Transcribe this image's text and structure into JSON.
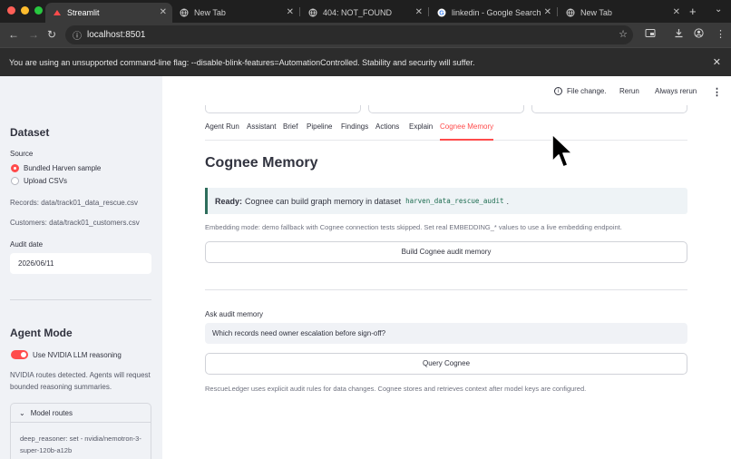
{
  "browser": {
    "tabs": [
      {
        "label": "Streamlit",
        "icon": "streamlit-icon",
        "active": true
      },
      {
        "label": "New Tab",
        "icon": "globe-icon",
        "active": false
      },
      {
        "label": "404: NOT_FOUND",
        "icon": "globe-icon",
        "active": false
      },
      {
        "label": "linkedin - Google Search",
        "icon": "google-icon",
        "active": false
      },
      {
        "label": "New Tab",
        "icon": "globe-icon",
        "active": false
      }
    ],
    "url": "localhost:8501",
    "infobar_message": "You are using an unsupported command-line flag: --disable-blink-features=AutomationControlled. Stability and security will suffer."
  },
  "header": {
    "file_change": "File change.",
    "rerun": "Rerun",
    "always_rerun": "Always rerun"
  },
  "sidebar": {
    "dataset_title": "Dataset",
    "source_label": "Source",
    "source_options": [
      "Bundled Harven sample",
      "Upload CSVs"
    ],
    "source_selected": "Bundled Harven sample",
    "records_path": "Records: data/track01_data_rescue.csv",
    "customers_path": "Customers: data/track01_customers.csv",
    "audit_date_label": "Audit date",
    "audit_date_value": "2026/06/11",
    "agent_mode_title": "Agent Mode",
    "toggle_label": "Use NVIDIA LLM reasoning",
    "toggle_on": true,
    "routes_note": "NVIDIA routes detected. Agents will request bounded reasoning summaries.",
    "expander_label": "Model routes",
    "expander_body": "deep_reasoner: set - nvidia/nemotron-3-super-120b-a12b"
  },
  "main": {
    "tabs": [
      "Agent Run",
      "Assistant",
      "Brief",
      "Pipeline",
      "Findings",
      "Actions",
      "Explain",
      "Cognee Memory"
    ],
    "active_tab": "Cognee Memory",
    "title": "Cognee Memory",
    "alert_bold": "Ready:",
    "alert_text": "Cognee can build graph memory in dataset",
    "alert_code": "harven_data_rescue_audit",
    "alert_end": ".",
    "embedding_caption": "Embedding mode: demo fallback with Cognee connection tests skipped. Set real EMBEDDING_* values to use a live embedding endpoint.",
    "build_button": "Build Cognee audit memory",
    "ask_label": "Ask audit memory",
    "ask_value": "Which records need owner escalation before sign-off?",
    "query_button": "Query Cognee",
    "footer_caption": "RescueLedger uses explicit audit rules for data changes. Cognee stores and retrieves context after model keys are configured."
  },
  "colors": {
    "accent": "#ff4b4b",
    "sidebar_bg": "#f0f2f6",
    "chrome_dark": "#1f1f1f"
  }
}
